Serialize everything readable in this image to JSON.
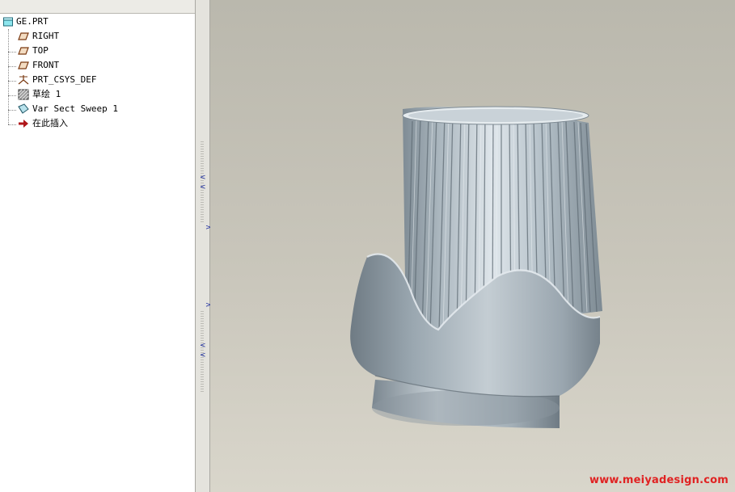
{
  "model_tree": {
    "items": [
      {
        "label": "GE.PRT",
        "icon": "part-icon"
      },
      {
        "label": "RIGHT",
        "icon": "datum-plane-icon"
      },
      {
        "label": "TOP",
        "icon": "datum-plane-icon"
      },
      {
        "label": "FRONT",
        "icon": "datum-plane-icon"
      },
      {
        "label": "PRT_CSYS_DEF",
        "icon": "coordinate-system-icon"
      },
      {
        "label": "草绘 1",
        "icon": "sketch-icon"
      },
      {
        "label": "Var Sect Sweep 1",
        "icon": "sweep-icon"
      },
      {
        "label": "在此插入",
        "icon": "insert-here-arrow-icon"
      }
    ]
  },
  "viewport": {
    "model_color": "#a9b4bb",
    "background_top": "#bab8ad",
    "background_bottom": "#d9d6cb"
  },
  "watermark": {
    "text": "www.meiyadesign.com",
    "color": "#e02222"
  }
}
